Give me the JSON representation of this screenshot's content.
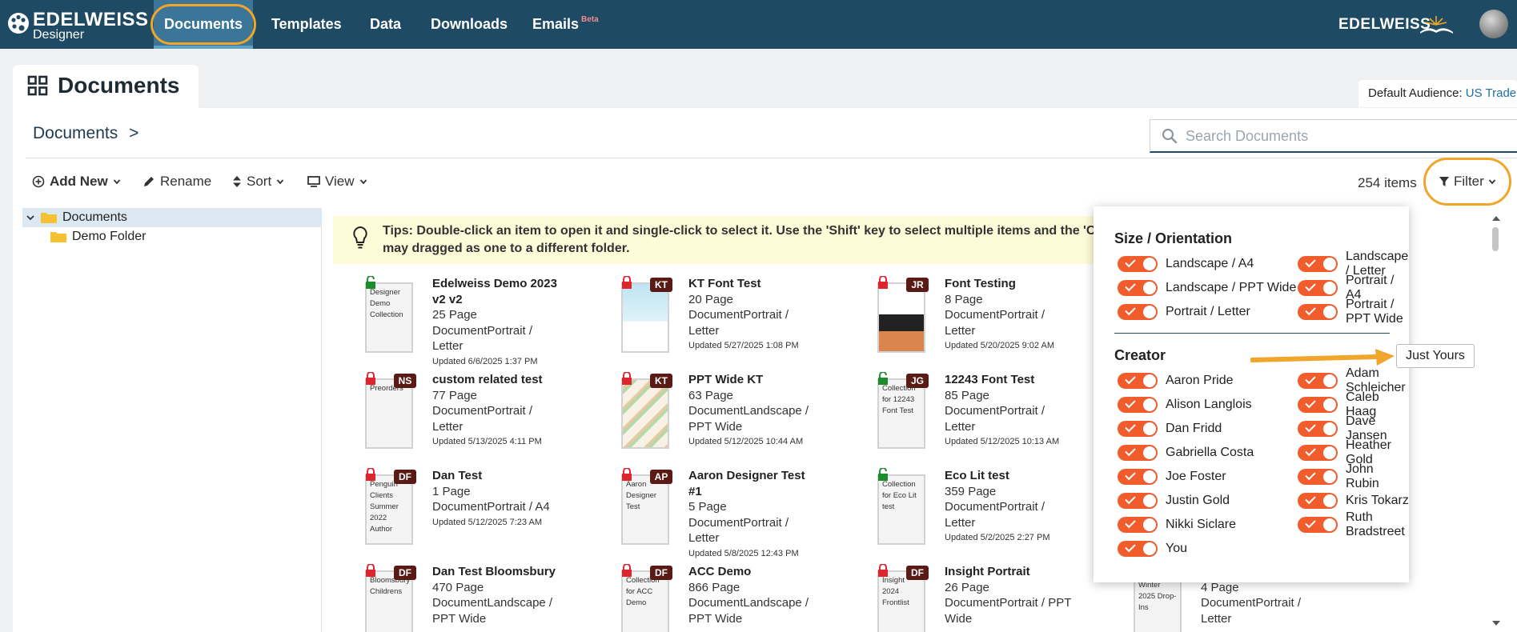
{
  "topnav": {
    "logo_brand": "EDELWEISS",
    "logo_sub": "Designer",
    "items": [
      {
        "label": "Documents"
      },
      {
        "label": "Templates"
      },
      {
        "label": "Data"
      },
      {
        "label": "Downloads"
      },
      {
        "label": "Emails",
        "badge": "Beta"
      }
    ],
    "brand_right": "EDELWEISS"
  },
  "page": {
    "title": "Documents",
    "audience_label": "Default Audience:",
    "audience_value": "US Trade",
    "breadcrumb": "Documents",
    "breadcrumb_sep": ">",
    "search_placeholder": "Search Documents"
  },
  "toolbar": {
    "add_new": "Add New",
    "rename": "Rename",
    "sort": "Sort",
    "view": "View",
    "items_count": "254 items",
    "filter": "Filter"
  },
  "tree": {
    "root": "Documents",
    "children": [
      "Demo Folder"
    ]
  },
  "tips": {
    "line1": "Tips: Double-click an item to open it and single-click to select it. Use the 'Shift' key to select multiple items and the 'Ctrl'",
    "line2": "may dragged as one to a different folder."
  },
  "documents": [
    {
      "title1": "Edelweiss Demo 2023",
      "title2": "v2 v2",
      "pages": "25 Page",
      "type1": "DocumentPortrait /",
      "type2": "Letter",
      "updated": "Updated 6/6/2025 1:37 PM",
      "lock": "open",
      "badge": "",
      "thumb": "Designer Demo Collection"
    },
    {
      "title1": "KT Font Test",
      "title2": "",
      "pages": "20 Page",
      "type1": "DocumentPortrait /",
      "type2": "Letter",
      "updated": "Updated 5/27/2025 1:08 PM",
      "lock": "closed",
      "badge": "KT",
      "thumb": ""
    },
    {
      "title1": "Font Testing",
      "title2": "",
      "pages": "8 Page",
      "type1": "DocumentPortrait /",
      "type2": "Letter",
      "updated": "Updated 5/20/2025 9:02 AM",
      "lock": "closed",
      "badge": "JR",
      "thumb": ""
    },
    {
      "title1": "custom related test",
      "title2": "",
      "pages": "77 Page",
      "type1": "DocumentPortrait /",
      "type2": "Letter",
      "updated": "Updated 5/13/2025 4:11 PM",
      "lock": "closed",
      "badge": "NS",
      "thumb": "Preorders"
    },
    {
      "title1": "PPT Wide KT",
      "title2": "",
      "pages": "63 Page",
      "type1": "DocumentLandscape /",
      "type2": "PPT Wide",
      "updated": "Updated 5/12/2025 10:44 AM",
      "lock": "closed",
      "badge": "KT",
      "thumb": ""
    },
    {
      "title1": "12243 Font Test",
      "title2": "",
      "pages": "85 Page",
      "type1": "DocumentPortrait /",
      "type2": "Letter",
      "updated": "Updated 5/12/2025 10:13 AM",
      "lock": "open",
      "badge": "JG",
      "thumb": "Collection for 12243 Font Test"
    },
    {
      "title1": "Dan Test",
      "title2": "",
      "pages": "1 Page",
      "type1": "DocumentPortrait / A4",
      "type2": "",
      "updated": "Updated 5/12/2025 7:23 AM",
      "lock": "closed",
      "badge": "DF",
      "thumb": "Penguin Clients Summer 2022 Author"
    },
    {
      "title1": "Aaron Designer Test",
      "title2": "#1",
      "pages": "5 Page",
      "type1": "DocumentPortrait /",
      "type2": "Letter",
      "updated": "Updated 5/8/2025 12:43 PM",
      "lock": "closed",
      "badge": "AP",
      "thumb": "Aaron Designer Test"
    },
    {
      "title1": "Eco Lit test",
      "title2": "",
      "pages": "359 Page",
      "type1": "DocumentPortrait /",
      "type2": "Letter",
      "updated": "Updated 5/2/2025 2:27 PM",
      "lock": "open",
      "badge": "",
      "thumb": "Collection for Eco Lit test"
    },
    {
      "title1": "Dan Test Bloomsbury",
      "title2": "",
      "pages": "470 Page",
      "type1": "DocumentLandscape /",
      "type2": "PPT Wide",
      "updated": "",
      "lock": "closed",
      "badge": "DF",
      "thumb": "Bloomsbury Childrens"
    },
    {
      "title1": "ACC Demo",
      "title2": "",
      "pages": "866 Page",
      "type1": "DocumentLandscape /",
      "type2": "PPT Wide",
      "updated": "",
      "lock": "closed",
      "badge": "DF",
      "thumb": "Collection for ACC Demo"
    },
    {
      "title1": "Insight Portrait",
      "title2": "",
      "pages": "26 Page",
      "type1": "DocumentPortrait / PPT",
      "type2": "Wide",
      "updated": "",
      "lock": "closed",
      "badge": "DF",
      "thumb": "Insight 2024 Frontlist"
    },
    {
      "title1": "",
      "title2": "",
      "pages": "4 Page",
      "type1": "DocumentPortrait /",
      "type2": "Letter",
      "updated": "",
      "lock": "none",
      "badge": "",
      "thumb": "Winter 2025 Drop-Ins"
    }
  ],
  "filter_panel": {
    "size_heading": "Size / Orientation",
    "sizes": [
      "Landscape / A4",
      "Landscape / Letter",
      "Landscape / PPT Wide",
      "Portrait / A4",
      "Portrait / Letter",
      "Portrait / PPT Wide"
    ],
    "creator_heading": "Creator",
    "just_yours": "Just Yours",
    "creators": [
      "Aaron Pride",
      "Adam Schleicher",
      "Alison Langlois",
      "Caleb Haag",
      "Dan Fridd",
      "Dave Jansen",
      "Gabriella Costa",
      "Heather Gold",
      "Joe Foster",
      "John Rubin",
      "Justin Gold",
      "Kris Tokarz",
      "Nikki Siclare",
      "Ruth Bradstreet",
      "You"
    ]
  },
  "colors": {
    "nav_bg": "#1f4a63",
    "nav_active": "#3b7597",
    "highlight": "#f0a62a",
    "toggle_on": "#f05c2c",
    "badge": "#5a1b16"
  }
}
